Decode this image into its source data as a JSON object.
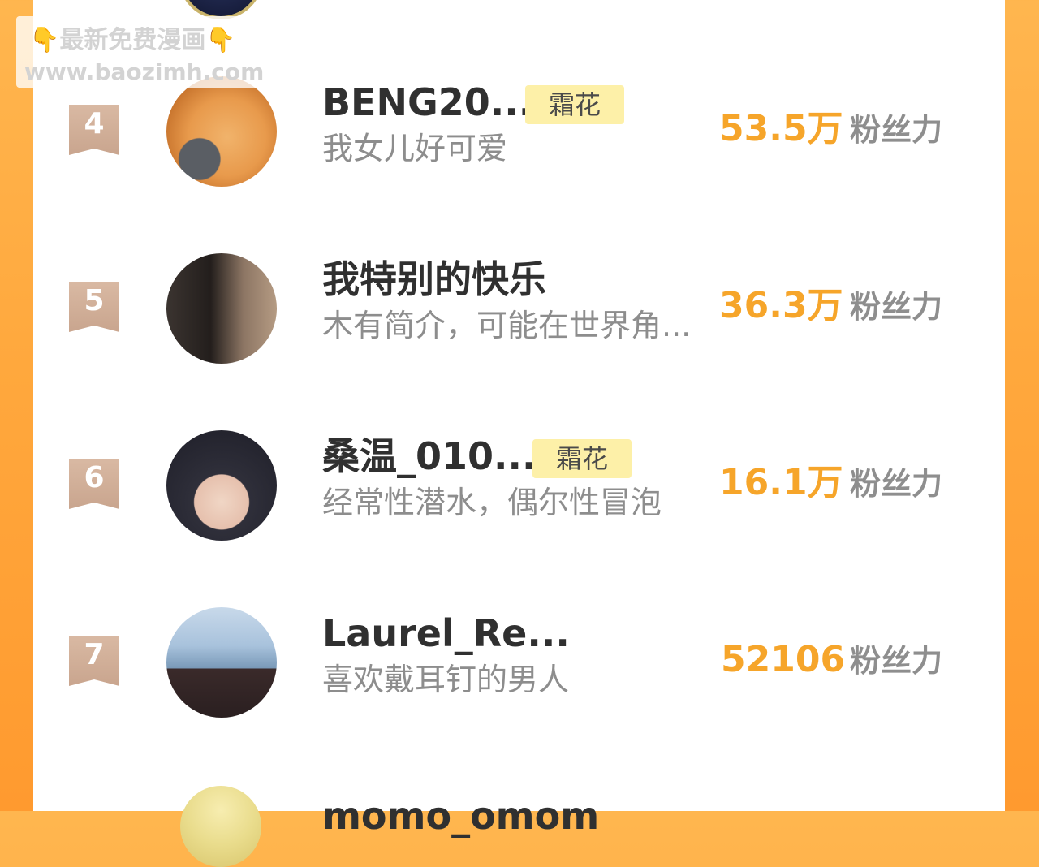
{
  "watermark": {
    "hand_left": "👇",
    "title": "最新免费漫画",
    "hand_right": "👇",
    "url": "www.baozimh.com"
  },
  "fans_label": "粉丝力",
  "rows": [
    {
      "rank": "4",
      "name": "BENG20...",
      "tag": "霜花",
      "bio": "我女儿好可爱",
      "fans": "53.5万",
      "avatar": "cat-avatar"
    },
    {
      "rank": "5",
      "name": "我特别的快乐",
      "tag": "",
      "bio": "木有简介，可能在世界角...",
      "fans": "36.3万",
      "avatar": "girl-avatar"
    },
    {
      "rank": "6",
      "name": "桑温_010...",
      "tag": "霜花",
      "bio": "经常性潜水，偶尔性冒泡",
      "fans": "16.1万",
      "avatar": "boy-avatar"
    },
    {
      "rank": "7",
      "name": "Laurel_Re...",
      "tag": "",
      "bio": "喜欢戴耳钉的男人",
      "fans": "52106",
      "avatar": "beach-avatar"
    }
  ],
  "next_row_partial_name": "momo_omom",
  "colors": {
    "accent_orange": "#f6a52a",
    "tag_bg": "#fdf0a8",
    "rank_badge": "#c9a58e",
    "frame": "#ffa83d"
  }
}
